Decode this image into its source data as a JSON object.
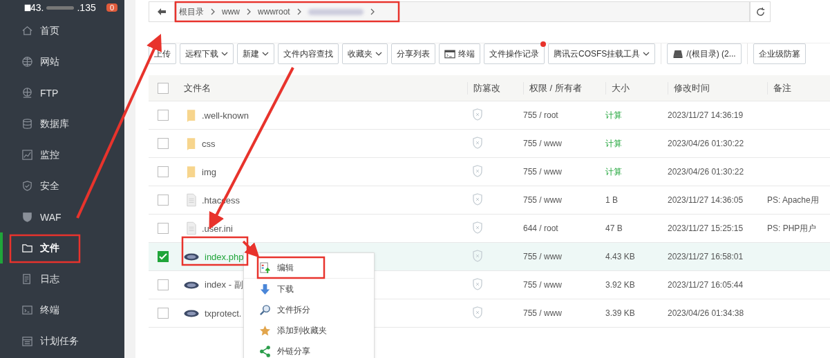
{
  "server": {
    "host_start": "43.",
    "host_end": ".135",
    "badge": "0"
  },
  "sidebar": {
    "items": [
      {
        "label": "首页",
        "kind": "home",
        "selected": false
      },
      {
        "label": "网站",
        "kind": "globe",
        "selected": false
      },
      {
        "label": "FTP",
        "kind": "ftp",
        "selected": false
      },
      {
        "label": "数据库",
        "kind": "db",
        "selected": false
      },
      {
        "label": "监控",
        "kind": "monitor",
        "selected": false
      },
      {
        "label": "安全",
        "kind": "shield",
        "selected": false
      },
      {
        "label": "WAF",
        "kind": "waf",
        "selected": false
      },
      {
        "label": "文件",
        "kind": "folder",
        "selected": true
      },
      {
        "label": "日志",
        "kind": "log",
        "selected": false
      },
      {
        "label": "终端",
        "kind": "terminal",
        "selected": false
      },
      {
        "label": "计划任务",
        "kind": "calendar",
        "selected": false
      }
    ]
  },
  "breadcrumb": {
    "segments": [
      "根目录",
      "www",
      "wwwroot"
    ]
  },
  "toolbar": [
    {
      "label": "上传",
      "kind": "plain"
    },
    {
      "label": "远程下载",
      "kind": "dropdown"
    },
    {
      "label": "新建",
      "kind": "dropdown"
    },
    {
      "label": "文件内容查找",
      "kind": "plain"
    },
    {
      "label": "收藏夹",
      "kind": "dropdown"
    },
    {
      "label": "分享列表",
      "kind": "plain"
    },
    {
      "label": "终端",
      "kind": "terminal"
    },
    {
      "label": "文件操作记录",
      "kind": "notify"
    },
    {
      "label": "腾讯云COSFS挂载工具",
      "kind": "dropdown"
    },
    {
      "label": "/(根目录) (2...",
      "kind": "disk"
    },
    {
      "label": "企业级防篡",
      "kind": "plain"
    }
  ],
  "table": {
    "all_selected": false,
    "columns": [
      "文件名",
      "防篡改",
      "权限 / 所有者",
      "大小",
      "修改时间",
      "备注"
    ],
    "rows": [
      {
        "name": ".well-known",
        "kind": "folder",
        "selected": false,
        "perm": "755 / root",
        "size": "计算",
        "size_is_link": true,
        "mtime": "2023/11/27 14:36:19"
      },
      {
        "name": "css",
        "kind": "folder",
        "selected": false,
        "perm": "755 / www",
        "size": "计算",
        "size_is_link": true,
        "mtime": "2023/04/26 01:30:22"
      },
      {
        "name": "img",
        "kind": "folder",
        "selected": false,
        "perm": "755 / www",
        "size": "计算",
        "size_is_link": true,
        "mtime": "2023/04/26 01:30:22"
      },
      {
        "name": ".htaccess",
        "kind": "file",
        "selected": false,
        "perm": "755 / www",
        "size": "1 B",
        "size_is_link": false,
        "mtime": "2023/11/27 14:36:05",
        "note": "PS: Apache用"
      },
      {
        "name": ".user.ini",
        "kind": "file",
        "selected": false,
        "perm": "644 / root",
        "size": "47 B",
        "size_is_link": false,
        "mtime": "2023/11/27 15:25:15",
        "note": "PS: PHP用户"
      },
      {
        "name": "index.php",
        "kind": "php",
        "selected": true,
        "perm": "755 / www",
        "size": "4.43 KB",
        "size_is_link": false,
        "mtime": "2023/11/27 16:58:01"
      },
      {
        "name": "index - 副",
        "kind": "php",
        "selected": false,
        "perm": "755 / www",
        "size": "3.92 KB",
        "size_is_link": false,
        "mtime": "2023/11/27 16:05:44"
      },
      {
        "name": "txprotect.",
        "kind": "php",
        "selected": false,
        "perm": "755 / www",
        "size": "3.39 KB",
        "size_is_link": false,
        "mtime": "2023/04/26 01:34:38"
      }
    ]
  },
  "context_menu": [
    {
      "label": "编辑",
      "kind": "edit"
    },
    {
      "label": "下载",
      "kind": "download"
    },
    {
      "label": "文件拆分",
      "kind": "split"
    },
    {
      "label": "添加到收藏夹",
      "kind": "star"
    },
    {
      "label": "外链分享",
      "kind": "share"
    }
  ]
}
